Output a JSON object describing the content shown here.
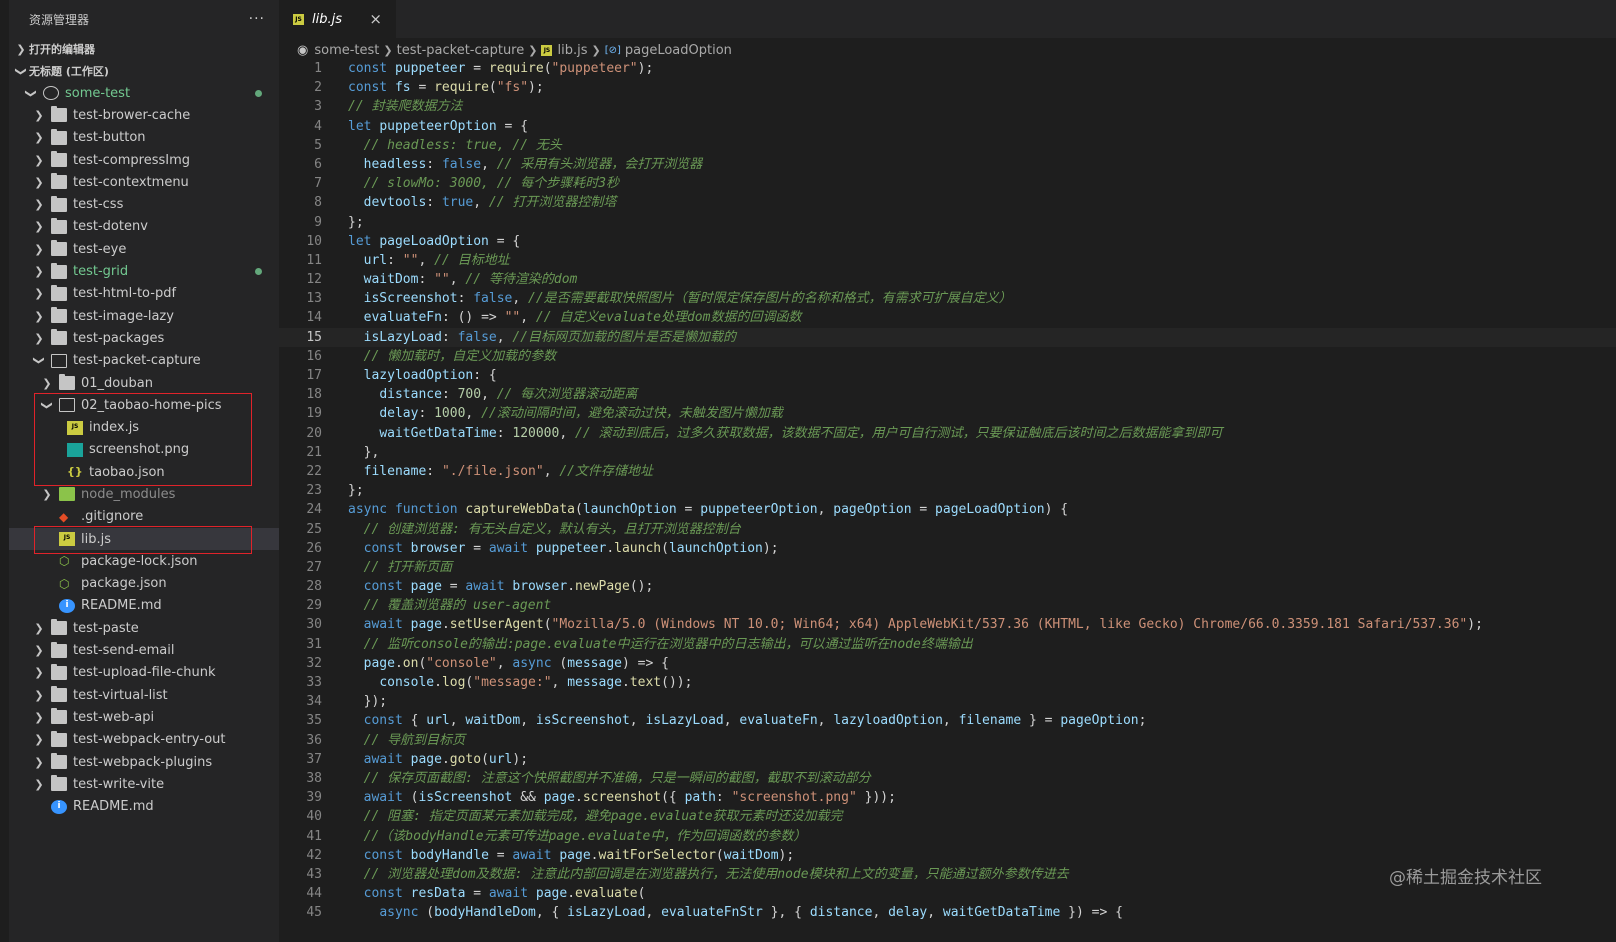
{
  "sidebar": {
    "title": "资源管理器",
    "more": "···",
    "open_editors": "打开的编辑器",
    "workspace": "无标题 (工作区)",
    "root": "some-test",
    "items": [
      {
        "label": "test-brower-cache",
        "type": "folder",
        "depth": 1
      },
      {
        "label": "test-button",
        "type": "folder",
        "depth": 1
      },
      {
        "label": "test-compressImg",
        "type": "folder",
        "depth": 1
      },
      {
        "label": "test-contextmenu",
        "type": "folder",
        "depth": 1
      },
      {
        "label": "test-css",
        "type": "folder",
        "depth": 1
      },
      {
        "label": "test-dotenv",
        "type": "folder",
        "depth": 1
      },
      {
        "label": "test-eye",
        "type": "folder",
        "depth": 1
      },
      {
        "label": "test-grid",
        "type": "folder",
        "depth": 1,
        "modified": true
      },
      {
        "label": "test-html-to-pdf",
        "type": "folder",
        "depth": 1
      },
      {
        "label": "test-image-lazy",
        "type": "folder",
        "depth": 1
      },
      {
        "label": "test-packages",
        "type": "folder",
        "depth": 1
      },
      {
        "label": "test-packet-capture",
        "type": "folder-open",
        "depth": 1
      },
      {
        "label": "01_douban",
        "type": "folder",
        "depth": 2
      },
      {
        "label": "02_taobao-home-pics",
        "type": "folder-open",
        "depth": 2
      },
      {
        "label": "index.js",
        "type": "js",
        "depth": 3
      },
      {
        "label": "screenshot.png",
        "type": "png",
        "depth": 3
      },
      {
        "label": "taobao.json",
        "type": "json",
        "depth": 3
      },
      {
        "label": "node_modules",
        "type": "node_modules",
        "depth": 2,
        "dim": true
      },
      {
        "label": ".gitignore",
        "type": "git",
        "depth": 2
      },
      {
        "label": "lib.js",
        "type": "js",
        "depth": 2,
        "selected": true
      },
      {
        "label": "package-lock.json",
        "type": "pkg",
        "depth": 2
      },
      {
        "label": "package.json",
        "type": "pkg",
        "depth": 2
      },
      {
        "label": "README.md",
        "type": "info",
        "depth": 2
      },
      {
        "label": "test-paste",
        "type": "folder",
        "depth": 1
      },
      {
        "label": "test-send-email",
        "type": "folder",
        "depth": 1
      },
      {
        "label": "test-upload-file-chunk",
        "type": "folder",
        "depth": 1
      },
      {
        "label": "test-virtual-list",
        "type": "folder",
        "depth": 1
      },
      {
        "label": "test-web-api",
        "type": "folder",
        "depth": 1
      },
      {
        "label": "test-webpack-entry-out",
        "type": "folder",
        "depth": 1
      },
      {
        "label": "test-webpack-plugins",
        "type": "folder",
        "depth": 1
      },
      {
        "label": "test-write-vite",
        "type": "folder",
        "depth": 1
      },
      {
        "label": "README.md",
        "type": "info",
        "depth": 1
      }
    ]
  },
  "editor": {
    "tab": {
      "label": "lib.js",
      "icon_text": "JS",
      "close": "×"
    },
    "breadcrumb": [
      "some-test",
      "test-packet-capture",
      "lib.js",
      "pageLoadOption"
    ],
    "current_line": 15,
    "lines": [
      [
        [
          "k",
          "const "
        ],
        [
          "v",
          "puppeteer"
        ],
        [
          "p",
          " = "
        ],
        [
          "f",
          "require"
        ],
        [
          "p",
          "("
        ],
        [
          "s",
          "\"puppeteer\""
        ],
        [
          "p",
          ");"
        ]
      ],
      [
        [
          "k",
          "const "
        ],
        [
          "v",
          "fs"
        ],
        [
          "p",
          " = "
        ],
        [
          "f",
          "require"
        ],
        [
          "p",
          "("
        ],
        [
          "s",
          "\"fs\""
        ],
        [
          "p",
          ");"
        ]
      ],
      [
        [
          "c",
          "// 封装爬数据方法"
        ]
      ],
      [
        [
          "k",
          "let "
        ],
        [
          "v",
          "puppeteerOption"
        ],
        [
          "p",
          " = {"
        ]
      ],
      [
        [
          "p",
          "  "
        ],
        [
          "c",
          "// headless: true, // 无头"
        ]
      ],
      [
        [
          "p",
          "  "
        ],
        [
          "pr",
          "headless"
        ],
        [
          "p",
          ": "
        ],
        [
          "k",
          "false"
        ],
        [
          "p",
          ", "
        ],
        [
          "c",
          "// 采用有头浏览器，会打开浏览器"
        ]
      ],
      [
        [
          "p",
          "  "
        ],
        [
          "c",
          "// slowMo: 3000, // 每个步骤耗时3秒"
        ]
      ],
      [
        [
          "p",
          "  "
        ],
        [
          "pr",
          "devtools"
        ],
        [
          "p",
          ": "
        ],
        [
          "k",
          "true"
        ],
        [
          "p",
          ", "
        ],
        [
          "c",
          "// 打开浏览器控制塔"
        ]
      ],
      [
        [
          "p",
          "};"
        ]
      ],
      [
        [
          "k",
          "let "
        ],
        [
          "v",
          "pageLoadOption"
        ],
        [
          "p",
          " = {"
        ]
      ],
      [
        [
          "p",
          "  "
        ],
        [
          "pr",
          "url"
        ],
        [
          "p",
          ": "
        ],
        [
          "s",
          "\"\""
        ],
        [
          "p",
          ", "
        ],
        [
          "c",
          "// 目标地址"
        ]
      ],
      [
        [
          "p",
          "  "
        ],
        [
          "pr",
          "waitDom"
        ],
        [
          "p",
          ": "
        ],
        [
          "s",
          "\"\""
        ],
        [
          "p",
          ", "
        ],
        [
          "c",
          "// 等待渲染的dom"
        ]
      ],
      [
        [
          "p",
          "  "
        ],
        [
          "pr",
          "isScreenshot"
        ],
        [
          "p",
          ": "
        ],
        [
          "k",
          "false"
        ],
        [
          "p",
          ", "
        ],
        [
          "c",
          "//是否需要截取快照图片（暂时限定保存图片的名称和格式，有需求可扩展自定义）"
        ]
      ],
      [
        [
          "p",
          "  "
        ],
        [
          "pr",
          "evaluateFn"
        ],
        [
          "p",
          ": () => "
        ],
        [
          "s",
          "\"\""
        ],
        [
          "p",
          ", "
        ],
        [
          "c",
          "// 自定义evaluate处理dom数据的回调函数"
        ]
      ],
      [
        [
          "p",
          "  "
        ],
        [
          "pr",
          "isLazyLoad"
        ],
        [
          "p",
          ": "
        ],
        [
          "k",
          "false"
        ],
        [
          "p",
          ", "
        ],
        [
          "c",
          "//目标网页加载的图片是否是懒加载的"
        ]
      ],
      [
        [
          "p",
          "  "
        ],
        [
          "c",
          "// 懒加载时，自定义加载的参数"
        ]
      ],
      [
        [
          "p",
          "  "
        ],
        [
          "pr",
          "lazyloadOption"
        ],
        [
          "p",
          ": {"
        ]
      ],
      [
        [
          "p",
          "    "
        ],
        [
          "pr",
          "distance"
        ],
        [
          "p",
          ": "
        ],
        [
          "n",
          "700"
        ],
        [
          "p",
          ", "
        ],
        [
          "c",
          "// 每次浏览器滚动距离"
        ]
      ],
      [
        [
          "p",
          "    "
        ],
        [
          "pr",
          "delay"
        ],
        [
          "p",
          ": "
        ],
        [
          "n",
          "1000"
        ],
        [
          "p",
          ", "
        ],
        [
          "c",
          "//滚动间隔时间，避免滚动过快，未触发图片懒加载"
        ]
      ],
      [
        [
          "p",
          "    "
        ],
        [
          "pr",
          "waitGetDataTime"
        ],
        [
          "p",
          ": "
        ],
        [
          "n",
          "120000"
        ],
        [
          "p",
          ", "
        ],
        [
          "c",
          "// 滚动到底后，过多久获取数据，该数据不固定，用户可自行测试，只要保证触底后该时间之后数据能拿到即可"
        ]
      ],
      [
        [
          "p",
          "  },"
        ]
      ],
      [
        [
          "p",
          "  "
        ],
        [
          "pr",
          "filename"
        ],
        [
          "p",
          ": "
        ],
        [
          "s",
          "\"./file.json\""
        ],
        [
          "p",
          ", "
        ],
        [
          "c",
          "//文件存储地址"
        ]
      ],
      [
        [
          "p",
          "};"
        ]
      ],
      [
        [
          "k",
          "async function "
        ],
        [
          "f",
          "captureWebData"
        ],
        [
          "p",
          "("
        ],
        [
          "v",
          "launchOption"
        ],
        [
          "p",
          " = "
        ],
        [
          "v",
          "puppeteerOption"
        ],
        [
          "p",
          ", "
        ],
        [
          "v",
          "pageOption"
        ],
        [
          "p",
          " = "
        ],
        [
          "v",
          "pageLoadOption"
        ],
        [
          "p",
          ") {"
        ]
      ],
      [
        [
          "p",
          "  "
        ],
        [
          "c",
          "// 创建浏览器: 有无头自定义，默认有头，且打开浏览器控制台"
        ]
      ],
      [
        [
          "p",
          "  "
        ],
        [
          "k",
          "const "
        ],
        [
          "v",
          "browser"
        ],
        [
          "p",
          " = "
        ],
        [
          "k",
          "await "
        ],
        [
          "v",
          "puppeteer"
        ],
        [
          "p",
          "."
        ],
        [
          "f",
          "launch"
        ],
        [
          "p",
          "("
        ],
        [
          "v",
          "launchOption"
        ],
        [
          "p",
          ");"
        ]
      ],
      [
        [
          "p",
          "  "
        ],
        [
          "c",
          "// 打开新页面"
        ]
      ],
      [
        [
          "p",
          "  "
        ],
        [
          "k",
          "const "
        ],
        [
          "v",
          "page"
        ],
        [
          "p",
          " = "
        ],
        [
          "k",
          "await "
        ],
        [
          "v",
          "browser"
        ],
        [
          "p",
          "."
        ],
        [
          "f",
          "newPage"
        ],
        [
          "p",
          "();"
        ]
      ],
      [
        [
          "p",
          "  "
        ],
        [
          "c",
          "// 覆盖浏览器的 user-agent"
        ]
      ],
      [
        [
          "p",
          "  "
        ],
        [
          "k",
          "await "
        ],
        [
          "v",
          "page"
        ],
        [
          "p",
          "."
        ],
        [
          "f",
          "setUserAgent"
        ],
        [
          "p",
          "("
        ],
        [
          "s",
          "\"Mozilla/5.0 (Windows NT 10.0; Win64; x64) AppleWebKit/537.36 (KHTML, like Gecko) Chrome/66.0.3359.181 Safari/537.36\""
        ],
        [
          "p",
          ");"
        ]
      ],
      [
        [
          "p",
          "  "
        ],
        [
          "c",
          "// 监听console的输出:page.evaluate中运行在浏览器中的日志输出，可以通过监听在node终端输出"
        ]
      ],
      [
        [
          "p",
          "  "
        ],
        [
          "v",
          "page"
        ],
        [
          "p",
          "."
        ],
        [
          "f",
          "on"
        ],
        [
          "p",
          "("
        ],
        [
          "s",
          "\"console\""
        ],
        [
          "p",
          ", "
        ],
        [
          "k",
          "async "
        ],
        [
          "p",
          "("
        ],
        [
          "v",
          "message"
        ],
        [
          "p",
          ") => {"
        ]
      ],
      [
        [
          "p",
          "    "
        ],
        [
          "v",
          "console"
        ],
        [
          "p",
          "."
        ],
        [
          "f",
          "log"
        ],
        [
          "p",
          "("
        ],
        [
          "s",
          "\"message:\""
        ],
        [
          "p",
          ", "
        ],
        [
          "v",
          "message"
        ],
        [
          "p",
          "."
        ],
        [
          "f",
          "text"
        ],
        [
          "p",
          "());"
        ]
      ],
      [
        [
          "p",
          "  });"
        ]
      ],
      [
        [
          "p",
          "  "
        ],
        [
          "k",
          "const "
        ],
        [
          "p",
          "{ "
        ],
        [
          "v",
          "url"
        ],
        [
          "p",
          ", "
        ],
        [
          "v",
          "waitDom"
        ],
        [
          "p",
          ", "
        ],
        [
          "v",
          "isScreenshot"
        ],
        [
          "p",
          ", "
        ],
        [
          "v",
          "isLazyLoad"
        ],
        [
          "p",
          ", "
        ],
        [
          "v",
          "evaluateFn"
        ],
        [
          "p",
          ", "
        ],
        [
          "v",
          "lazyloadOption"
        ],
        [
          "p",
          ", "
        ],
        [
          "v",
          "filename"
        ],
        [
          "p",
          " } = "
        ],
        [
          "v",
          "pageOption"
        ],
        [
          "p",
          ";"
        ]
      ],
      [
        [
          "p",
          "  "
        ],
        [
          "c",
          "// 导航到目标页"
        ]
      ],
      [
        [
          "p",
          "  "
        ],
        [
          "k",
          "await "
        ],
        [
          "v",
          "page"
        ],
        [
          "p",
          "."
        ],
        [
          "f",
          "goto"
        ],
        [
          "p",
          "("
        ],
        [
          "v",
          "url"
        ],
        [
          "p",
          ");"
        ]
      ],
      [
        [
          "p",
          "  "
        ],
        [
          "c",
          "// 保存页面截图: 注意这个快照截图并不准确，只是一瞬间的截图，截取不到滚动部分"
        ]
      ],
      [
        [
          "p",
          "  "
        ],
        [
          "k",
          "await "
        ],
        [
          "p",
          "("
        ],
        [
          "v",
          "isScreenshot"
        ],
        [
          "p",
          " && "
        ],
        [
          "v",
          "page"
        ],
        [
          "p",
          "."
        ],
        [
          "f",
          "screenshot"
        ],
        [
          "p",
          "({ "
        ],
        [
          "pr",
          "path"
        ],
        [
          "p",
          ": "
        ],
        [
          "s",
          "\"screenshot.png\""
        ],
        [
          "p",
          " }));"
        ]
      ],
      [
        [
          "p",
          "  "
        ],
        [
          "c",
          "// 阻塞: 指定页面某元素加载完成，避免page.evaluate获取元素时还没加载完"
        ]
      ],
      [
        [
          "p",
          "  "
        ],
        [
          "c",
          "//（该bodyHandle元素可传进page.evaluate中，作为回调函数的参数）"
        ]
      ],
      [
        [
          "p",
          "  "
        ],
        [
          "k",
          "const "
        ],
        [
          "v",
          "bodyHandle"
        ],
        [
          "p",
          " = "
        ],
        [
          "k",
          "await "
        ],
        [
          "v",
          "page"
        ],
        [
          "p",
          "."
        ],
        [
          "f",
          "waitForSelector"
        ],
        [
          "p",
          "("
        ],
        [
          "v",
          "waitDom"
        ],
        [
          "p",
          ");"
        ]
      ],
      [
        [
          "p",
          "  "
        ],
        [
          "c",
          "// 浏览器处理dom及数据: 注意此内部回调是在浏览器执行，无法使用node模块和上文的变量，只能通过额外参数传进去"
        ]
      ],
      [
        [
          "p",
          "  "
        ],
        [
          "k",
          "const "
        ],
        [
          "v",
          "resData"
        ],
        [
          "p",
          " = "
        ],
        [
          "k",
          "await "
        ],
        [
          "v",
          "page"
        ],
        [
          "p",
          "."
        ],
        [
          "f",
          "evaluate"
        ],
        [
          "p",
          "("
        ]
      ],
      [
        [
          "p",
          "    "
        ],
        [
          "k",
          "async "
        ],
        [
          "p",
          "("
        ],
        [
          "v",
          "bodyHandleDom"
        ],
        [
          "p",
          ", { "
        ],
        [
          "v",
          "isLazyLoad"
        ],
        [
          "p",
          ", "
        ],
        [
          "v",
          "evaluateFnStr"
        ],
        [
          "p",
          " }, { "
        ],
        [
          "v",
          "distance"
        ],
        [
          "p",
          ", "
        ],
        [
          "v",
          "delay"
        ],
        [
          "p",
          ", "
        ],
        [
          "v",
          "waitGetDataTime"
        ],
        [
          "p",
          " }) => {"
        ]
      ]
    ]
  },
  "watermark": "@稀土掘金技术社区",
  "colors": {
    "keyword": "#569cd6",
    "variable": "#9cdcfe",
    "function": "#dcdcaa",
    "string": "#ce9178",
    "number": "#b5cea8",
    "comment": "#6a9955",
    "property": "#9cdcfe",
    "punct": "#d4d4d4",
    "highlight_box": "#e0232a"
  }
}
